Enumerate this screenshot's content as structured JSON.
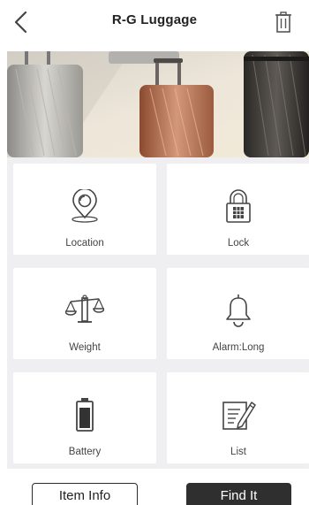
{
  "header": {
    "title": "R-G Luggage",
    "back_icon": "chevron-left-icon",
    "delete_icon": "trash-icon"
  },
  "hero": {
    "image": "luggage-photo"
  },
  "tiles": [
    {
      "label": "Location",
      "icon": "location-pin-icon"
    },
    {
      "label": "Lock",
      "icon": "padlock-icon"
    },
    {
      "label": "Weight",
      "icon": "scale-icon"
    },
    {
      "label": "Alarm:Long",
      "icon": "bell-icon"
    },
    {
      "label": "Battery",
      "icon": "battery-icon"
    },
    {
      "label": "List",
      "icon": "list-edit-icon"
    }
  ],
  "actions": {
    "item_info": "Item Info",
    "find_it": "Find It"
  },
  "colors": {
    "grid_background": "#efeff1",
    "primary_button": "#2f2f2f",
    "tile_background": "#ffffff"
  }
}
